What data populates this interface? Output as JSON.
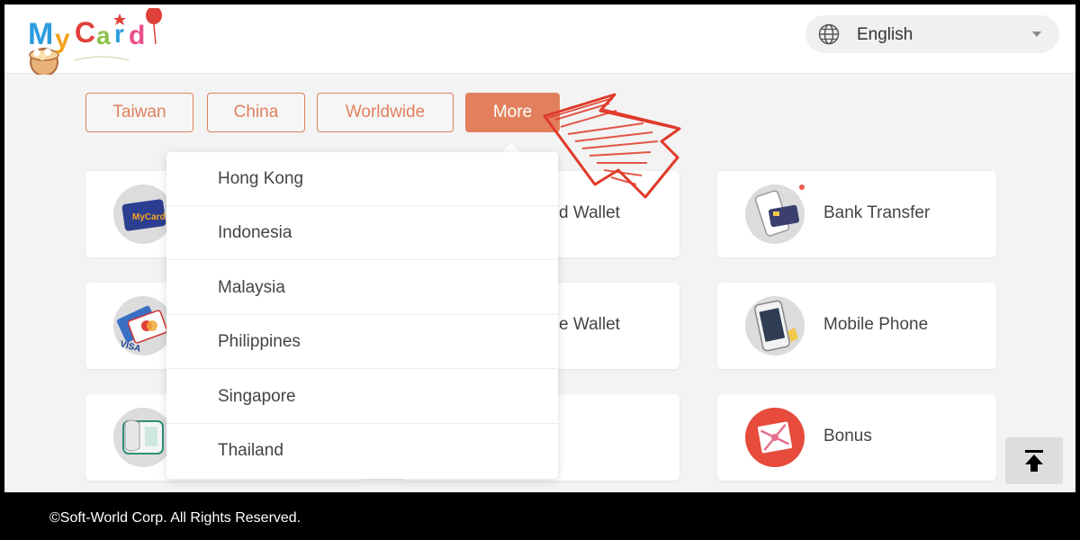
{
  "brand": {
    "logo_text": "MyCard"
  },
  "header": {
    "language": "English",
    "icons": [
      "globe-icon",
      "chevron-down-icon"
    ]
  },
  "region_tabs": [
    {
      "label": "Taiwan",
      "active": false
    },
    {
      "label": "China",
      "active": false
    },
    {
      "label": "Worldwide",
      "active": false
    },
    {
      "label": "More",
      "active": true
    }
  ],
  "dropdown": {
    "items": [
      "Hong Kong",
      "Indonesia",
      "Malaysia",
      "Philippines",
      "Singapore",
      "Thailand"
    ]
  },
  "payment_methods": [
    {
      "label": "",
      "icon": "mycard-card-icon"
    },
    {
      "label": "d Wallet",
      "icon": ""
    },
    {
      "label": "Bank Transfer",
      "icon": "bank-transfer-phone-icon"
    },
    {
      "label": "",
      "icon": "credit-card-icon"
    },
    {
      "label": "e Wallet",
      "icon": ""
    },
    {
      "label": "Mobile Phone",
      "icon": "mobile-phone-icon"
    },
    {
      "label": "",
      "icon": "telephone-icon"
    },
    {
      "label": "",
      "icon": ""
    },
    {
      "label": "Bonus",
      "icon": "gift-icon"
    }
  ],
  "back_to_top_icon": "arrow-to-top-icon",
  "footer": {
    "copyright": "©Soft-World Corp. All Rights Reserved."
  },
  "colors": {
    "accent": "#e2805d",
    "annotation": "#e03a2a",
    "background": "#f3f3f3"
  }
}
